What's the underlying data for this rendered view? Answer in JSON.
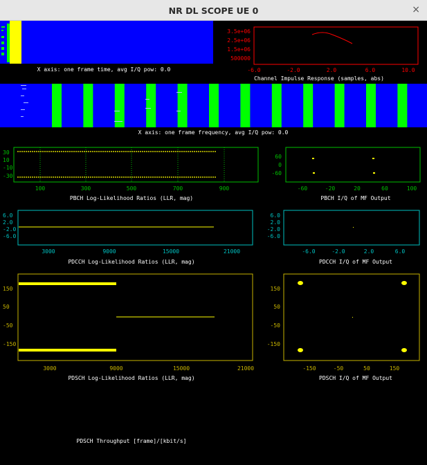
{
  "window": {
    "title": "NR DL SCOPE UE 0",
    "close_glyph": "×"
  },
  "colors": {
    "bg": "#000000",
    "blue": "#0000ff",
    "green": "#00ff00",
    "yellow": "#ffff00",
    "red": "#ff0000",
    "white": "#ffffff"
  },
  "time_panel": {
    "caption": "X axis: one frame time, avg I/Q pow:  0.0"
  },
  "cir_panel": {
    "caption": "Channel Impulse Response (samples, abs)",
    "yticks": [
      "3.5e+06",
      "2.5e+06",
      "1.5e+06",
      "500000"
    ],
    "xticks": [
      "-6.0",
      "-2.0",
      "2.0",
      "6.0",
      "10.0"
    ]
  },
  "freq_panel": {
    "caption": "X axis: one frame frequency, avg I/Q pow:  0.0"
  },
  "pbch_llr": {
    "caption": "PBCH Log-Likelihood Ratios (LLR, mag)",
    "yticks": [
      "30",
      "10",
      "-10",
      "-30"
    ],
    "xticks": [
      "100",
      "300",
      "500",
      "700",
      "900"
    ]
  },
  "pbch_iq": {
    "caption": "PBCH I/Q of MF Output",
    "yticks": [
      "60",
      "0",
      "-60"
    ],
    "xticks": [
      "-60",
      "-20",
      "20",
      "60",
      "100"
    ]
  },
  "pdcch_llr": {
    "caption": "PDCCH Log-Likelihood Ratios (LLR, mag)",
    "yticks": [
      "6.0",
      "2.0",
      "-2.0",
      "-6.0"
    ],
    "xticks": [
      "3000",
      "9000",
      "15000",
      "21000"
    ]
  },
  "pdcch_iq": {
    "caption": "PDCCH I/Q of MF Output",
    "yticks": [
      "6.0",
      "2.0",
      "-2.0",
      "-6.0"
    ],
    "xticks": [
      "-6.0",
      "-2.0",
      "2.0",
      "6.0"
    ]
  },
  "pdsch_llr": {
    "caption": "PDSCH Log-Likelihood Ratios (LLR, mag)",
    "yticks": [
      "150",
      "50",
      "-50",
      "-150"
    ],
    "xticks": [
      "3000",
      "9000",
      "15000",
      "21000"
    ]
  },
  "pdsch_iq": {
    "caption": "PDSCH I/Q of MF Output",
    "yticks": [
      "150",
      "50",
      "-50",
      "-150"
    ],
    "xticks": [
      "-150",
      "-50",
      "50",
      "150"
    ]
  },
  "throughput": {
    "caption": "PDSCH Throughput [frame]/[kbit/s]"
  }
}
